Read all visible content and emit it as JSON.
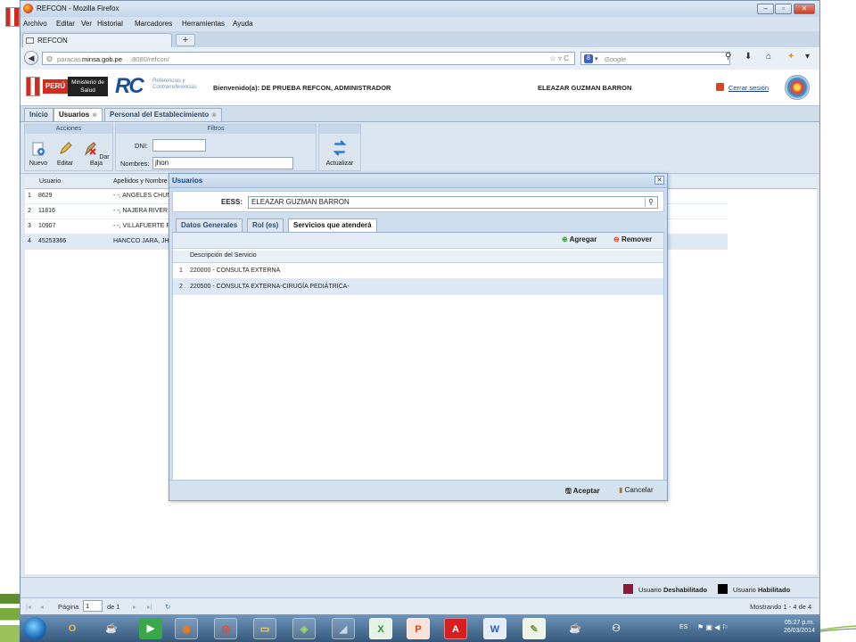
{
  "browser": {
    "title": "REFCON - Mozilla Firefox",
    "menu": [
      "Archivo",
      "Editar",
      "Ver",
      "Historial",
      "Marcadores",
      "Herramientas",
      "Ayuda"
    ],
    "tab_label": "REFCON",
    "url_prefix": "paracas.",
    "url_domain": "minsa.gob.pe",
    "url_rest": ":8080/refcon/",
    "search_placeholder": "Google"
  },
  "header": {
    "peru_label": "PERÚ",
    "ministerio_label": "Ministerio de Salud",
    "rc_logo": "RC",
    "rc_subtitle": "Referencias y Contrarreferencias",
    "welcome": "Bienvenido(a): DE PRUEBA REFCON, ADMINISTRADOR",
    "user_name": "ELEAZAR GUZMAN BARRON",
    "logout": "Cerrar sesión"
  },
  "app_tabs": [
    {
      "label": "Inicio",
      "closable": false
    },
    {
      "label": "Usuarios",
      "closable": true
    },
    {
      "label": "Personal del Establecimiento",
      "closable": true
    }
  ],
  "toolbar": {
    "acciones_title": "Acciones",
    "filtros_title": "Filtros",
    "nuevo": "Nuevo",
    "editar": "Editar",
    "dar_baja": "Dar Baja",
    "dni_label": "DNI:",
    "dni_value": "",
    "nombres_label": "Nombres:",
    "nombres_value": "jhon",
    "actualizar": "Actualizar"
  },
  "grid": {
    "columns": [
      "Usuario",
      "Apellidos y Nombre"
    ],
    "rows": [
      {
        "n": "1",
        "usuario": "8629",
        "nombre": "- -, ANGELES CHUN"
      },
      {
        "n": "2",
        "usuario": "11816",
        "nombre": "- -, NAJERA RIVER"
      },
      {
        "n": "3",
        "usuario": "10907",
        "nombre": "- -, VILLAFUERTE F"
      },
      {
        "n": "4",
        "usuario": "45253366",
        "nombre": "HANCCO JARA, JH"
      }
    ]
  },
  "legend": {
    "deshabilitado_prefix": "Usuario",
    "deshabilitado_bold": "Deshabilitado",
    "habilitado_prefix": "Usuario",
    "habilitado_bold": "Habilitado",
    "deshabilitado_color": "#8b1a3a",
    "habilitado_color": "#000000"
  },
  "pager": {
    "pagina_label": "Página",
    "page_value": "1",
    "of_label": "de 1",
    "summary": "Mostrando 1 - 4 de 4"
  },
  "modal": {
    "title": "Usuarios",
    "eess_label": "EESS:",
    "eess_value": "ELEAZAR GUZMAN BARRON",
    "tabs": [
      "Datos Generales",
      "Rol (es)",
      "Servicios que atenderá"
    ],
    "agregar": "Agregar",
    "remover": "Remover",
    "column": "Descripción del Servicio",
    "rows": [
      {
        "n": "1",
        "desc": "220000 - CONSULTA EXTERNA"
      },
      {
        "n": "2",
        "desc": "220500 - CONSULTA EXTERNA-CIRUGÍA PEDIÁTRICA-"
      }
    ],
    "aceptar": "Aceptar",
    "cancelar": "Cancelar"
  },
  "taskbar": {
    "lang": "ES",
    "time": "05:27 p.m.",
    "date": "26/03/2014"
  }
}
